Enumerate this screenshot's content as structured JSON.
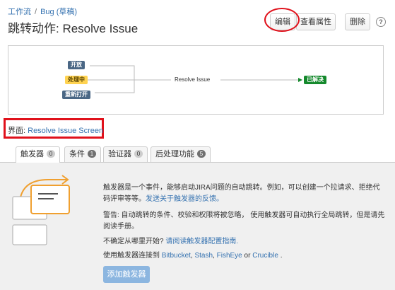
{
  "breadcrumb": {
    "workflow": "工作流",
    "separator": "/",
    "bug": "Bug (草稿)"
  },
  "title": "跳转动作: Resolve Issue",
  "toolbar": {
    "edit": "编辑",
    "view_props": "查看属性",
    "delete": "删除",
    "help": "?"
  },
  "diagram": {
    "states": [
      "开放",
      "处理中",
      "重新打开"
    ],
    "transition": "Resolve Issue",
    "target": "已解决"
  },
  "screen": {
    "label": "界面:",
    "name": "Resolve Issue Screen"
  },
  "tabs": [
    {
      "label": "触发器",
      "count": "0"
    },
    {
      "label": "条件",
      "count": "1"
    },
    {
      "label": "验证器",
      "count": "0"
    },
    {
      "label": "后处理功能",
      "count": "5"
    }
  ],
  "panel": {
    "p1": "触发器是一个事件，能够启动JIRA问题的自动跳转。例如，可以创建一个拉请求、拒绝代码评审等等。",
    "p1_link": "发送关于触发器的反馈。",
    "p2": "警告: 自动跳转的条件、校验和权限将被忽略， 使用触发器可自动执行全局跳转，但是请先阅读手册。",
    "p3": "不确定从哪里开始?",
    "p3_link": "请阅读触发器配置指南.",
    "p4_prefix": "使用触发器连接到",
    "bitbucket": "Bitbucket",
    "stash": "Stash",
    "fisheye": "FishEye",
    "crucible": "Crucible",
    "or": "or",
    "comma": ",",
    "dot": ".",
    "add_button": "添加触发器"
  },
  "colors": {
    "link": "#3572b0",
    "highlight": "#e0111b",
    "resolved": "#14892c",
    "in_progress": "#ffd351"
  }
}
